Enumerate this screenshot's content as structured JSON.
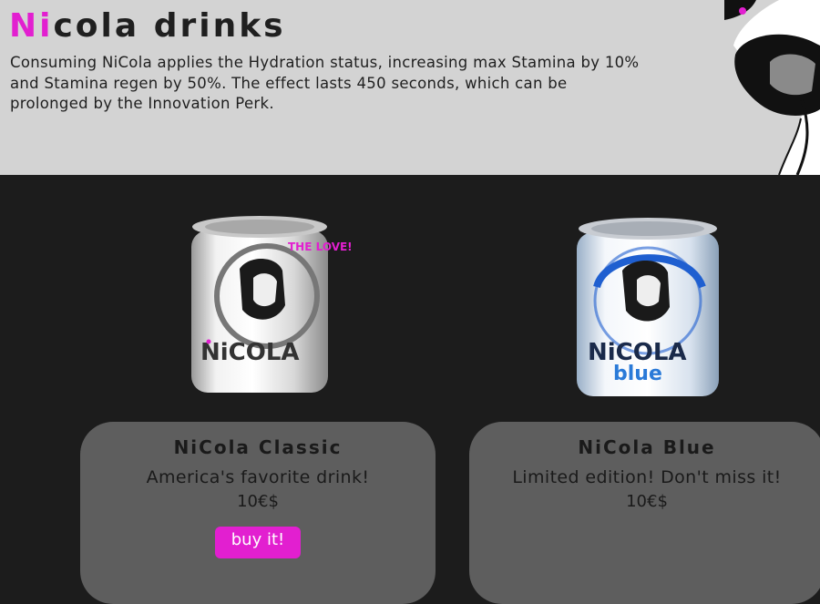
{
  "header": {
    "title_accent": "Ni",
    "title_rest": "cola drinks",
    "description": "Consuming NiCola applies the Hydration status, increasing max Stamina by 10% and Stamina regen by 50%. The effect lasts 450 seconds, which can be prolonged by the Innovation Perk."
  },
  "products": [
    {
      "name": "NiCola Classic",
      "tagline": "America's favorite drink!",
      "price": "10€$",
      "buy_label": "buy it!",
      "can_brand": "NiCOLA",
      "can_slogan": "THE LOVE!"
    },
    {
      "name": "NiCola Blue",
      "tagline": "Limited edition! Don't miss it!",
      "price": "10€$",
      "can_brand": "NiCOLA",
      "can_variant": "blue"
    }
  ],
  "colors": {
    "accent": "#e21fd0",
    "header_bg": "#d3d3d3",
    "page_bg": "#1c1c1c",
    "card_bg": "#5e5e5e",
    "blue_accent": "#1f5fd0"
  }
}
